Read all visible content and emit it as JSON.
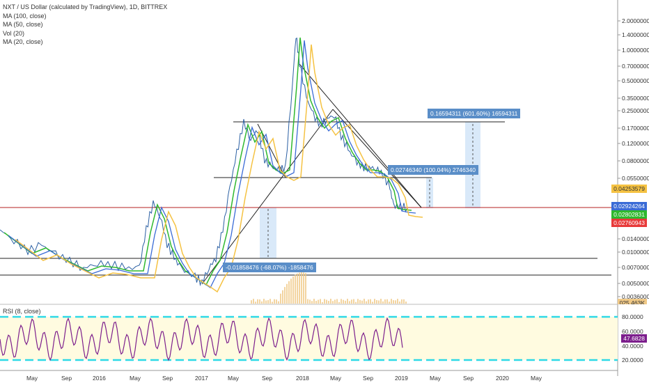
{
  "legend": {
    "title": "NXT / US Dollar (calculated by TradingView), 1D, BITTREX",
    "indicators": [
      "MA (100, close)",
      "MA (50, close)",
      "Vol (20)",
      "MA (20, close)"
    ]
  },
  "rsi_legend": "RSI (8, close)",
  "price_axis": [
    "2.00000000",
    "1.40000000",
    "1.00000000",
    "0.70000000",
    "0.50000000",
    "0.35000000",
    "0.25000000",
    "0.17000000",
    "0.12000000",
    "0.08000000",
    "0.05500000",
    "0.01400000",
    "0.01000000",
    "0.00700000",
    "0.00500000",
    "0.00360000"
  ],
  "rsi_axis": [
    "80.0000",
    "60.0000",
    "40.0000",
    "20.0000"
  ],
  "price_tags": {
    "ma_yellow": {
      "text": "0.04253579",
      "color": "#f5c242",
      "text_color": "#333"
    },
    "ma_blue": {
      "text": "0.02924264",
      "color": "#3a6bd6",
      "text_color": "#fff"
    },
    "ma_green": {
      "text": "0.02802831",
      "color": "#2eb82e",
      "text_color": "#fff"
    },
    "last": {
      "text": "0.02760943",
      "color": "#e83a3a",
      "text_color": "#fff"
    },
    "rsi": {
      "text": "47.6828",
      "color": "#7c1e8c",
      "text_color": "#fff"
    },
    "volume_partial": {
      "text": "025.463K",
      "color": "#f0c987",
      "text_color": "#333"
    }
  },
  "annotations": {
    "up_big": "0.16594311 (601.60%) 16594311",
    "up_small": "0.02746340 (100.04%) 2746340",
    "down": "-0.01858476 (-68.07%) -1858476"
  },
  "time_axis": [
    "May",
    "Sep",
    "2016",
    "May",
    "Sep",
    "2017",
    "May",
    "Sep",
    "2018",
    "May",
    "Sep",
    "2019",
    "May",
    "Sep",
    "2020",
    "May"
  ],
  "colors": {
    "price_line": "#2a5fa3",
    "ma100": "#f5c242",
    "ma50": "#3a6bd6",
    "ma20": "#2eb82e",
    "rsi": "#7c1e8c",
    "rsi_band": "#fffbe0",
    "rsi_levels": "#2ed9e6",
    "horizontal_red": "#b52020",
    "measure_fill": "#cfe3f7"
  }
}
